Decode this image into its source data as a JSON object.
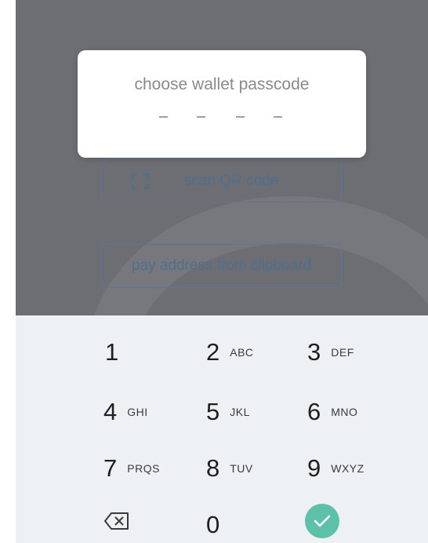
{
  "wallet": {
    "scan_label": "scan QR code",
    "scan_icon": "qr-scan-icon",
    "pay_label": "pay address from clipboard"
  },
  "dialog": {
    "title": "choose wallet passcode",
    "entered_digits": 0,
    "total_digits": 4
  },
  "keypad": {
    "keys": [
      {
        "digit": "1",
        "letters": ""
      },
      {
        "digit": "2",
        "letters": "ABC"
      },
      {
        "digit": "3",
        "letters": "DEF"
      },
      {
        "digit": "4",
        "letters": "GHI"
      },
      {
        "digit": "5",
        "letters": "JKL"
      },
      {
        "digit": "6",
        "letters": "MNO"
      },
      {
        "digit": "7",
        "letters": "PRQS"
      },
      {
        "digit": "8",
        "letters": "TUV"
      },
      {
        "digit": "9",
        "letters": "WXYZ"
      },
      {
        "digit": "0",
        "letters": ""
      }
    ],
    "backspace_icon": "backspace-icon",
    "confirm_icon": "checkmark-icon"
  },
  "colors": {
    "accent": "#5cc1a8",
    "button_border": "#5b7794",
    "overlay": "#6d6e73",
    "keypad_bg": "#eef1f4"
  }
}
